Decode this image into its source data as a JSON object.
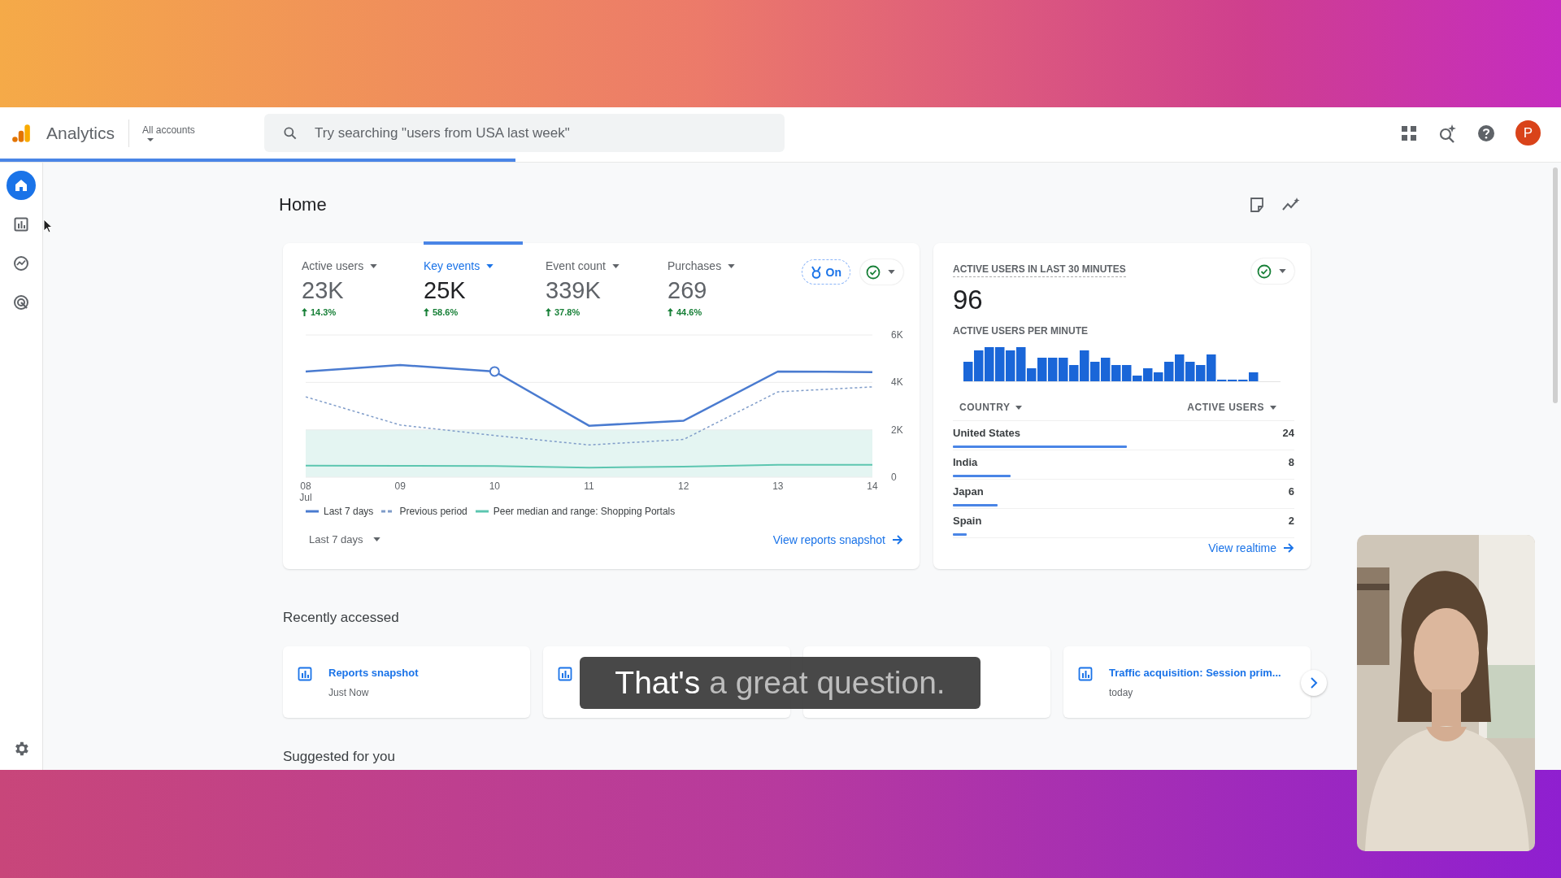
{
  "header": {
    "app_name": "Analytics",
    "account_label": "All accounts",
    "search": {
      "placeholder": "Try searching \"users from USA last week\""
    },
    "avatar": "P"
  },
  "loading_bar": {
    "level": 0.33
  },
  "rail": [
    {
      "kind": "home",
      "selected": true
    },
    {
      "kind": "reports",
      "selected": false
    },
    {
      "kind": "explore",
      "selected": false
    },
    {
      "kind": "advertising",
      "selected": false
    }
  ],
  "page_title": "Home",
  "overview": {
    "metrics": [
      {
        "label": "Active users",
        "value": "23K",
        "change": "14.3%",
        "selected": false
      },
      {
        "label": "Key events",
        "value": "25K",
        "change": "58.6%",
        "selected": true
      },
      {
        "label": "Event count",
        "value": "339K",
        "change": "37.8%",
        "selected": false
      },
      {
        "label": "Purchases",
        "value": "269",
        "change": "44.6%",
        "selected": false
      }
    ],
    "badge": "On",
    "chart_data": {
      "type": "line",
      "categories": [
        "08",
        "09",
        "10",
        "11",
        "12",
        "13",
        "14"
      ],
      "ylim": [
        0,
        6000
      ],
      "yticks": [
        0,
        {
          "value": 2000,
          "label": "2K"
        },
        {
          "value": 4000,
          "label": "4K"
        },
        {
          "value": 6000,
          "label": "6K"
        }
      ],
      "series": [
        {
          "name": "Last 7 days",
          "color": "#4a7bd0",
          "values": [
            4460,
            4730,
            4460,
            2170,
            2380,
            4460,
            4430
          ]
        },
        {
          "name": "Previous period",
          "color": "#7f9cc9",
          "line_style": "dashed",
          "values": [
            3390,
            2200,
            1760,
            1360,
            1590,
            3600,
            3810
          ]
        },
        {
          "name": "Peer median and range: Shopping Portals",
          "color": "#5cc6b0",
          "values": [
            490,
            480,
            470,
            400,
            450,
            520,
            520
          ]
        }
      ],
      "bands": [
        {
          "axis": "y",
          "from": 0,
          "to": 2000,
          "color": "#e4f5f2"
        }
      ],
      "annotations": [
        {
          "x": "10"
        }
      ]
    },
    "month_label": "Jul",
    "range_button": "Last 7 days",
    "link": "View reports snapshot"
  },
  "realtime": {
    "title": "ACTIVE USERS IN LAST 30 MINUTES",
    "value": "96",
    "per_minute_title": "ACTIVE USERS PER MINUTE",
    "columns": [
      "COUNTRY",
      "ACTIVE USERS"
    ],
    "rows": [
      {
        "country": "United States",
        "users": "24",
        "level": 0.51
      },
      {
        "country": "India",
        "users": "8",
        "level": 0.17
      },
      {
        "country": "Japan",
        "users": "6",
        "level": 0.13
      },
      {
        "country": "Spain",
        "users": "2",
        "level": 0.04
      }
    ],
    "link": "View realtime"
  },
  "recent": {
    "title": "Recently accessed",
    "items": [
      {
        "icon": true,
        "title": "Reports snapshot",
        "time": "Just Now"
      },
      {
        "icon": true
      },
      {
        "icon": false
      },
      {
        "icon": true,
        "title": "Traffic acquisition: Session prim...",
        "time": "today"
      }
    ]
  },
  "suggested": {
    "title": "Suggested for you"
  },
  "caption": {
    "spoken": "That's",
    "upcoming": "a great question."
  }
}
